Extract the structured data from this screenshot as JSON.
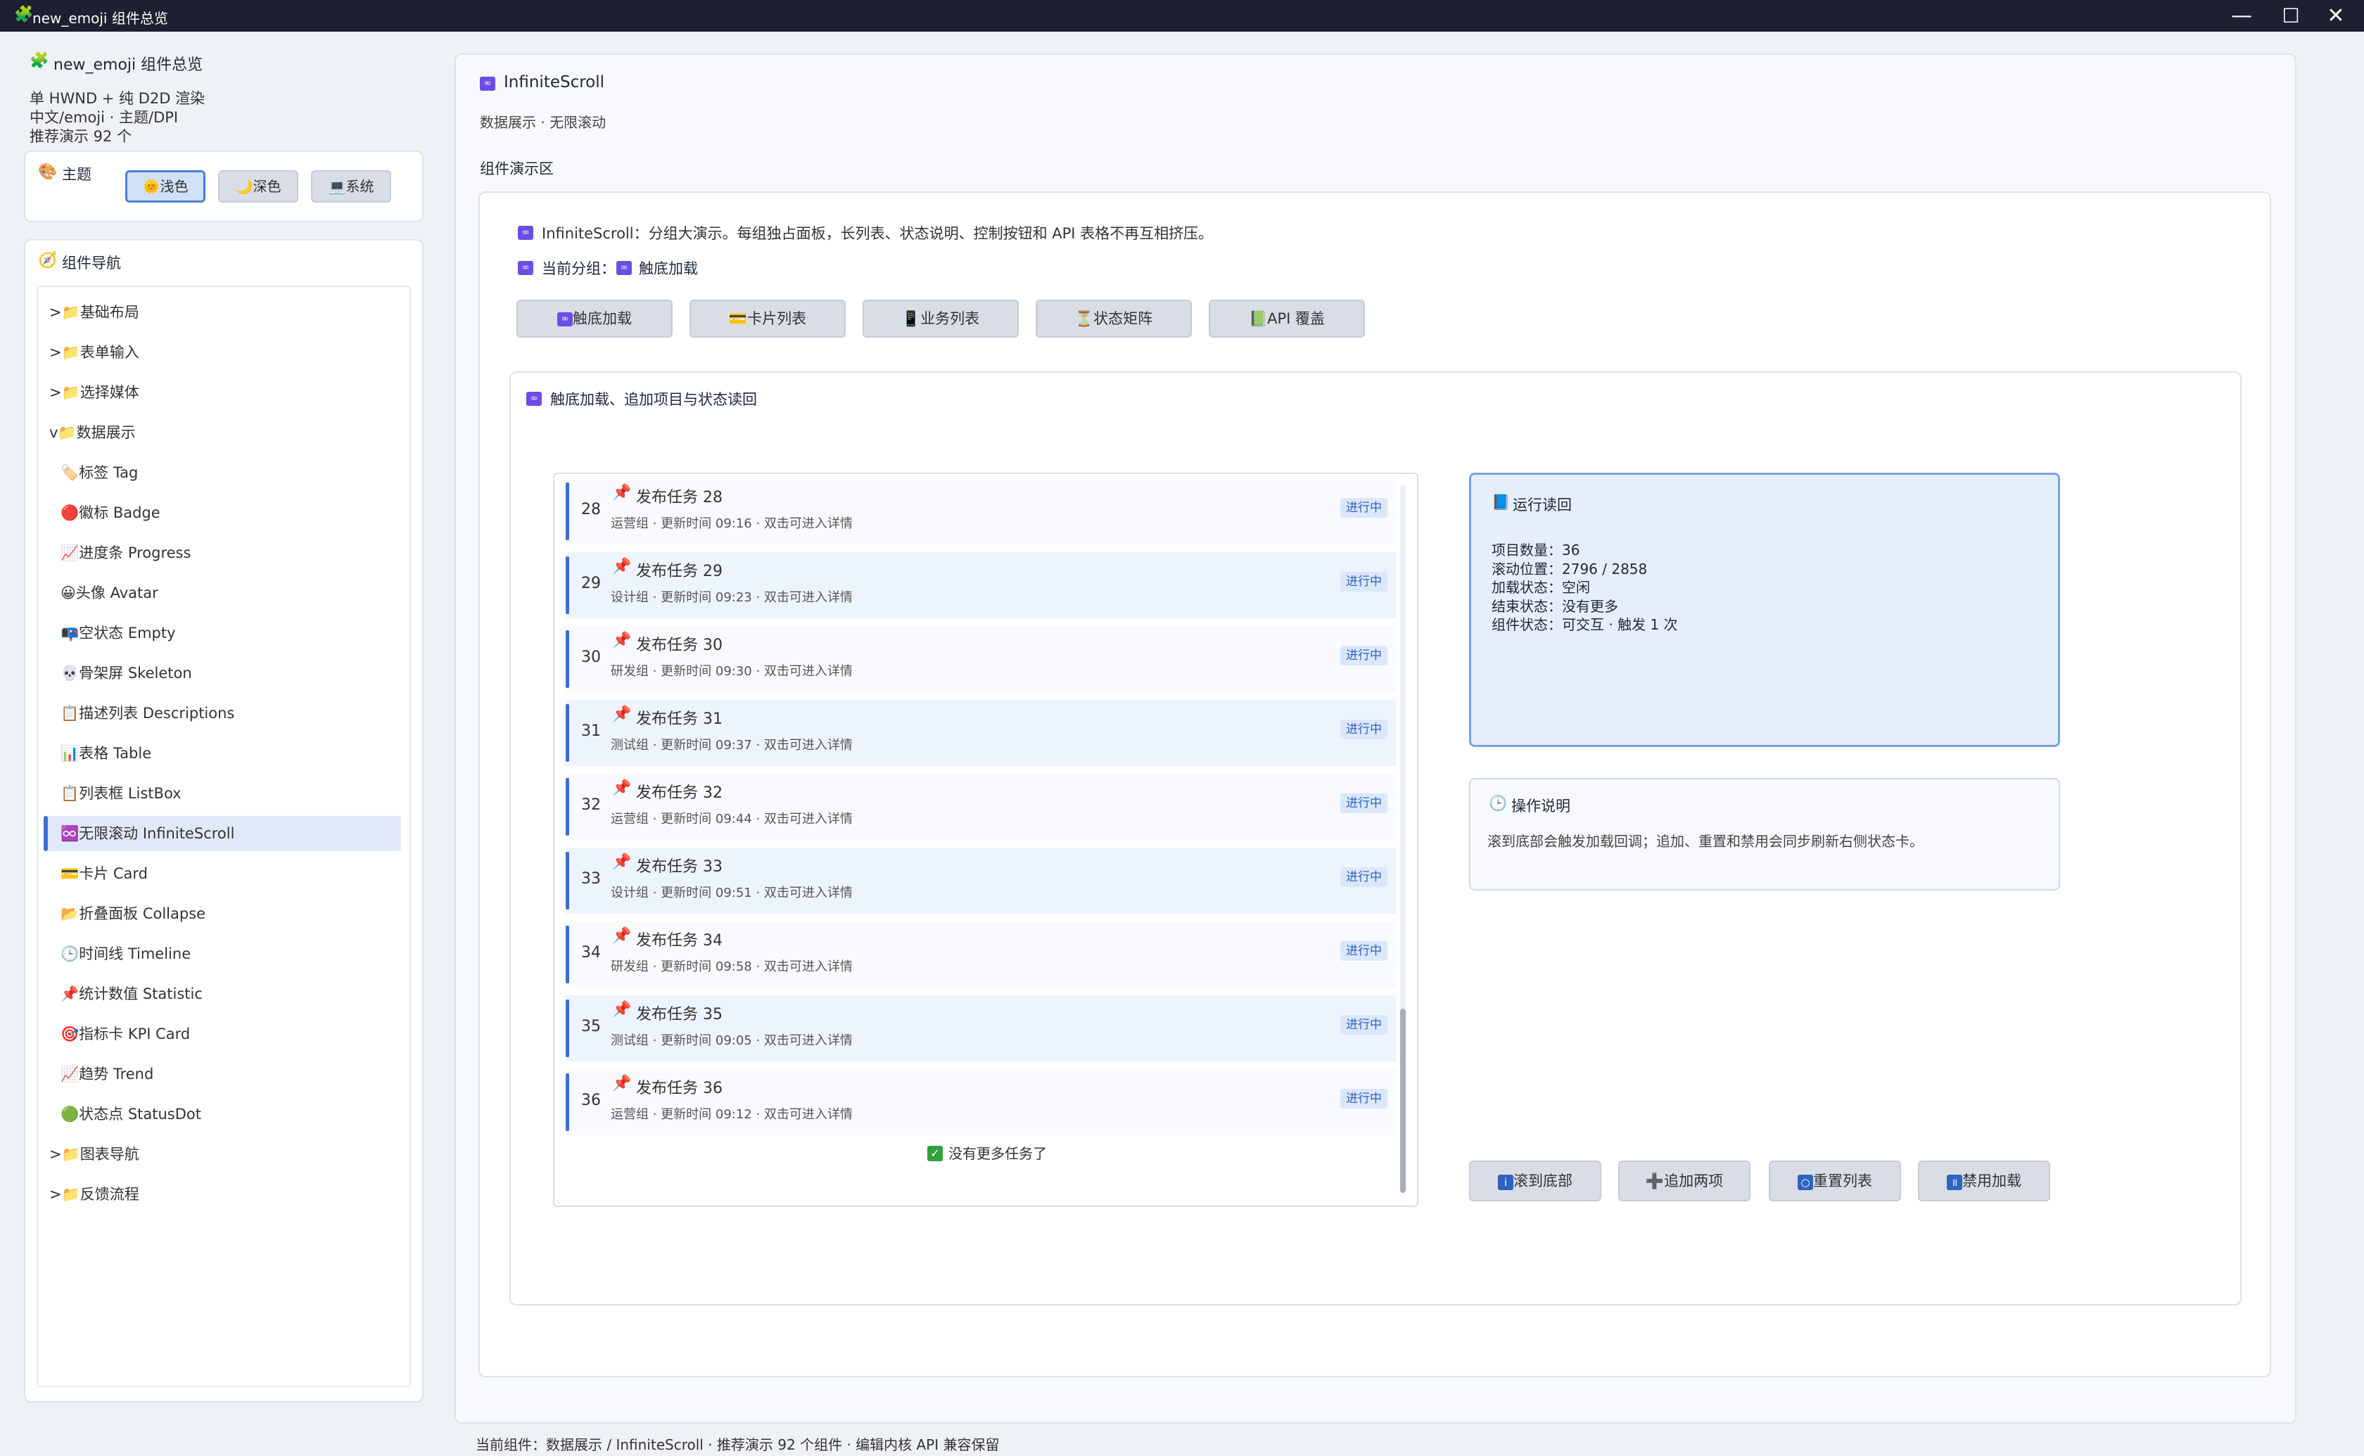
{
  "window": {
    "title": "new_emoji 组件总览",
    "icon": "puzzle-icon",
    "controls": [
      "—",
      "☐",
      "✕"
    ]
  },
  "app": {
    "title": "new_emoji 组件总览",
    "info": [
      "单 HWND + 纯 D2D 渲染",
      "中文/emoji · 主题/DPI",
      "推荐演示 92 个"
    ]
  },
  "theme": {
    "label": "主题",
    "options": [
      "浅色",
      "深色",
      "系统"
    ],
    "selected": "浅色"
  },
  "nav": {
    "title": "组件导航",
    "items": [
      {
        "label": ">📁基础布局",
        "child": false
      },
      {
        "label": ">📁表单输入",
        "child": false
      },
      {
        "label": ">📁选择媒体",
        "child": false
      },
      {
        "label": "v📁数据展示",
        "child": false
      },
      {
        "label": "🏷️标签 Tag",
        "child": true
      },
      {
        "label": "🔴徽标 Badge",
        "child": true
      },
      {
        "label": "📈进度条 Progress",
        "child": true
      },
      {
        "label": "😀头像 Avatar",
        "child": true
      },
      {
        "label": "📭空状态 Empty",
        "child": true
      },
      {
        "label": "💀骨架屏 Skeleton",
        "child": true
      },
      {
        "label": "📋描述列表 Descriptions",
        "child": true
      },
      {
        "label": "📊表格 Table",
        "child": true
      },
      {
        "label": "📋列表框 ListBox",
        "child": true
      },
      {
        "label": "♾️无限滚动 InfiniteScroll",
        "child": true
      },
      {
        "label": "💳卡片 Card",
        "child": true
      },
      {
        "label": "📂折叠面板 Collapse",
        "child": true
      },
      {
        "label": "🕒时间线 Timeline",
        "child": true
      },
      {
        "label": "📌统计数值 Statistic",
        "child": true
      },
      {
        "label": "🎯指标卡 KPI Card",
        "child": true
      },
      {
        "label": "📈趋势 Trend",
        "child": true
      },
      {
        "label": "🟢状态点 StatusDot",
        "child": true
      },
      {
        "label": ">📁图表导航",
        "child": false
      },
      {
        "label": ">📁反馈流程",
        "child": false
      }
    ],
    "selected_index": 13
  },
  "main": {
    "title": "InfiniteScroll",
    "subtitle": "数据展示 · 无限滚动",
    "demo_area_label": "组件演示区",
    "desc": "InfiniteScroll：分组大演示。每组独占面板，长列表、状态说明、控制按钮和 API 表格不再互相挤压。",
    "group_label": "当前分组：",
    "group_value": "触底加载",
    "groups": [
      "触底加载",
      "卡片列表",
      "业务列表",
      "状态矩阵",
      "API 覆盖"
    ],
    "group_icons": [
      "infinity-icon",
      "card-icon",
      "phone-icon",
      "hourglass-icon",
      "api-icon"
    ],
    "panel_title": "触底加载、追加项目与状态读回",
    "list": {
      "rows": [
        {
          "num": "28",
          "title": "发布任务 28",
          "sub": "运营组 · 更新时间 09:16 · 双击可进入详情",
          "badge": "进行中"
        },
        {
          "num": "29",
          "title": "发布任务 29",
          "sub": "设计组 · 更新时间 09:23 · 双击可进入详情",
          "badge": "进行中"
        },
        {
          "num": "30",
          "title": "发布任务 30",
          "sub": "研发组 · 更新时间 09:30 · 双击可进入详情",
          "badge": "进行中"
        },
        {
          "num": "31",
          "title": "发布任务 31",
          "sub": "测试组 · 更新时间 09:37 · 双击可进入详情",
          "badge": "进行中"
        },
        {
          "num": "32",
          "title": "发布任务 32",
          "sub": "运营组 · 更新时间 09:44 · 双击可进入详情",
          "badge": "进行中"
        },
        {
          "num": "33",
          "title": "发布任务 33",
          "sub": "设计组 · 更新时间 09:51 · 双击可进入详情",
          "badge": "进行中"
        },
        {
          "num": "34",
          "title": "发布任务 34",
          "sub": "研发组 · 更新时间 09:58 · 双击可进入详情",
          "badge": "进行中"
        },
        {
          "num": "35",
          "title": "发布任务 35",
          "sub": "测试组 · 更新时间 09:05 · 双击可进入详情",
          "badge": "进行中"
        },
        {
          "num": "36",
          "title": "发布任务 36",
          "sub": "运营组 · 更新时间 09:12 · 双击可进入详情",
          "badge": "进行中"
        }
      ],
      "end_text": "没有更多任务了"
    },
    "readback": {
      "title": "运行读回",
      "lines": [
        "项目数量：36",
        "滚动位置：2796 / 2858",
        "加载状态：空闲",
        "结束状态：没有更多",
        "组件状态：可交互 · 触发 1 次"
      ]
    },
    "help": {
      "title": "操作说明",
      "text": "滚到底部会触发加载回调；追加、重置和禁用会同步刷新右侧状态卡。"
    },
    "actions": [
      "滚到底部",
      "追加两项",
      "重置列表",
      "禁用加载"
    ]
  },
  "status_bar": "当前组件：数据展示 / InfiniteScroll · 推荐演示 92 个组件 · 编辑内核 API 兼容保留",
  "colors": {
    "accent": "#3b6fd4",
    "titlebar": "#1c2030",
    "selected_bg": "#e1e9f8",
    "badge_bg": "#dbe7fb"
  }
}
